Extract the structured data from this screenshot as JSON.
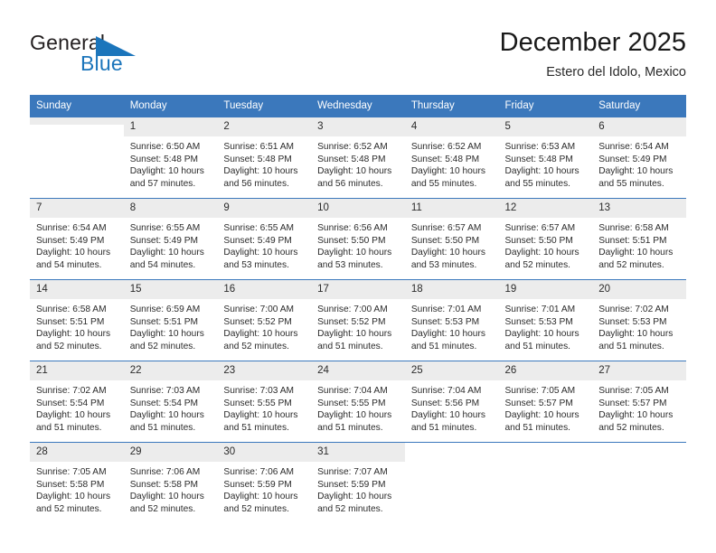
{
  "brand": {
    "name_part1": "General",
    "name_part2": "Blue",
    "triangle_icon": "triangle-icon",
    "colors": {
      "black": "#231f20",
      "blue": "#1b75bb"
    }
  },
  "header": {
    "title": "December 2025",
    "subtitle": "Estero del Idolo, Mexico"
  },
  "theme": {
    "header_blue": "#3b78bc",
    "daynum_gray": "#ececec",
    "text": "#2b2b2b"
  },
  "weekday_headers": [
    "Sunday",
    "Monday",
    "Tuesday",
    "Wednesday",
    "Thursday",
    "Friday",
    "Saturday"
  ],
  "labels": {
    "sunrise_prefix": "Sunrise: ",
    "sunset_prefix": "Sunset: ",
    "daylight_prefix": "Daylight: "
  },
  "weeks": [
    [
      {
        "day": "",
        "blank": true
      },
      {
        "day": "1",
        "sunrise": "Sunrise: 6:50 AM",
        "sunset": "Sunset: 5:48 PM",
        "daylight": "Daylight: 10 hours and 57 minutes."
      },
      {
        "day": "2",
        "sunrise": "Sunrise: 6:51 AM",
        "sunset": "Sunset: 5:48 PM",
        "daylight": "Daylight: 10 hours and 56 minutes."
      },
      {
        "day": "3",
        "sunrise": "Sunrise: 6:52 AM",
        "sunset": "Sunset: 5:48 PM",
        "daylight": "Daylight: 10 hours and 56 minutes."
      },
      {
        "day": "4",
        "sunrise": "Sunrise: 6:52 AM",
        "sunset": "Sunset: 5:48 PM",
        "daylight": "Daylight: 10 hours and 55 minutes."
      },
      {
        "day": "5",
        "sunrise": "Sunrise: 6:53 AM",
        "sunset": "Sunset: 5:48 PM",
        "daylight": "Daylight: 10 hours and 55 minutes."
      },
      {
        "day": "6",
        "sunrise": "Sunrise: 6:54 AM",
        "sunset": "Sunset: 5:49 PM",
        "daylight": "Daylight: 10 hours and 55 minutes."
      }
    ],
    [
      {
        "day": "7",
        "sunrise": "Sunrise: 6:54 AM",
        "sunset": "Sunset: 5:49 PM",
        "daylight": "Daylight: 10 hours and 54 minutes."
      },
      {
        "day": "8",
        "sunrise": "Sunrise: 6:55 AM",
        "sunset": "Sunset: 5:49 PM",
        "daylight": "Daylight: 10 hours and 54 minutes."
      },
      {
        "day": "9",
        "sunrise": "Sunrise: 6:55 AM",
        "sunset": "Sunset: 5:49 PM",
        "daylight": "Daylight: 10 hours and 53 minutes."
      },
      {
        "day": "10",
        "sunrise": "Sunrise: 6:56 AM",
        "sunset": "Sunset: 5:50 PM",
        "daylight": "Daylight: 10 hours and 53 minutes."
      },
      {
        "day": "11",
        "sunrise": "Sunrise: 6:57 AM",
        "sunset": "Sunset: 5:50 PM",
        "daylight": "Daylight: 10 hours and 53 minutes."
      },
      {
        "day": "12",
        "sunrise": "Sunrise: 6:57 AM",
        "sunset": "Sunset: 5:50 PM",
        "daylight": "Daylight: 10 hours and 52 minutes."
      },
      {
        "day": "13",
        "sunrise": "Sunrise: 6:58 AM",
        "sunset": "Sunset: 5:51 PM",
        "daylight": "Daylight: 10 hours and 52 minutes."
      }
    ],
    [
      {
        "day": "14",
        "sunrise": "Sunrise: 6:58 AM",
        "sunset": "Sunset: 5:51 PM",
        "daylight": "Daylight: 10 hours and 52 minutes."
      },
      {
        "day": "15",
        "sunrise": "Sunrise: 6:59 AM",
        "sunset": "Sunset: 5:51 PM",
        "daylight": "Daylight: 10 hours and 52 minutes."
      },
      {
        "day": "16",
        "sunrise": "Sunrise: 7:00 AM",
        "sunset": "Sunset: 5:52 PM",
        "daylight": "Daylight: 10 hours and 52 minutes."
      },
      {
        "day": "17",
        "sunrise": "Sunrise: 7:00 AM",
        "sunset": "Sunset: 5:52 PM",
        "daylight": "Daylight: 10 hours and 51 minutes."
      },
      {
        "day": "18",
        "sunrise": "Sunrise: 7:01 AM",
        "sunset": "Sunset: 5:53 PM",
        "daylight": "Daylight: 10 hours and 51 minutes."
      },
      {
        "day": "19",
        "sunrise": "Sunrise: 7:01 AM",
        "sunset": "Sunset: 5:53 PM",
        "daylight": "Daylight: 10 hours and 51 minutes."
      },
      {
        "day": "20",
        "sunrise": "Sunrise: 7:02 AM",
        "sunset": "Sunset: 5:53 PM",
        "daylight": "Daylight: 10 hours and 51 minutes."
      }
    ],
    [
      {
        "day": "21",
        "sunrise": "Sunrise: 7:02 AM",
        "sunset": "Sunset: 5:54 PM",
        "daylight": "Daylight: 10 hours and 51 minutes."
      },
      {
        "day": "22",
        "sunrise": "Sunrise: 7:03 AM",
        "sunset": "Sunset: 5:54 PM",
        "daylight": "Daylight: 10 hours and 51 minutes."
      },
      {
        "day": "23",
        "sunrise": "Sunrise: 7:03 AM",
        "sunset": "Sunset: 5:55 PM",
        "daylight": "Daylight: 10 hours and 51 minutes."
      },
      {
        "day": "24",
        "sunrise": "Sunrise: 7:04 AM",
        "sunset": "Sunset: 5:55 PM",
        "daylight": "Daylight: 10 hours and 51 minutes."
      },
      {
        "day": "25",
        "sunrise": "Sunrise: 7:04 AM",
        "sunset": "Sunset: 5:56 PM",
        "daylight": "Daylight: 10 hours and 51 minutes."
      },
      {
        "day": "26",
        "sunrise": "Sunrise: 7:05 AM",
        "sunset": "Sunset: 5:57 PM",
        "daylight": "Daylight: 10 hours and 51 minutes."
      },
      {
        "day": "27",
        "sunrise": "Sunrise: 7:05 AM",
        "sunset": "Sunset: 5:57 PM",
        "daylight": "Daylight: 10 hours and 52 minutes."
      }
    ],
    [
      {
        "day": "28",
        "sunrise": "Sunrise: 7:05 AM",
        "sunset": "Sunset: 5:58 PM",
        "daylight": "Daylight: 10 hours and 52 minutes."
      },
      {
        "day": "29",
        "sunrise": "Sunrise: 7:06 AM",
        "sunset": "Sunset: 5:58 PM",
        "daylight": "Daylight: 10 hours and 52 minutes."
      },
      {
        "day": "30",
        "sunrise": "Sunrise: 7:06 AM",
        "sunset": "Sunset: 5:59 PM",
        "daylight": "Daylight: 10 hours and 52 minutes."
      },
      {
        "day": "31",
        "sunrise": "Sunrise: 7:07 AM",
        "sunset": "Sunset: 5:59 PM",
        "daylight": "Daylight: 10 hours and 52 minutes."
      },
      {
        "day": "",
        "blank": true
      },
      {
        "day": "",
        "blank": true
      },
      {
        "day": "",
        "blank": true
      }
    ]
  ]
}
